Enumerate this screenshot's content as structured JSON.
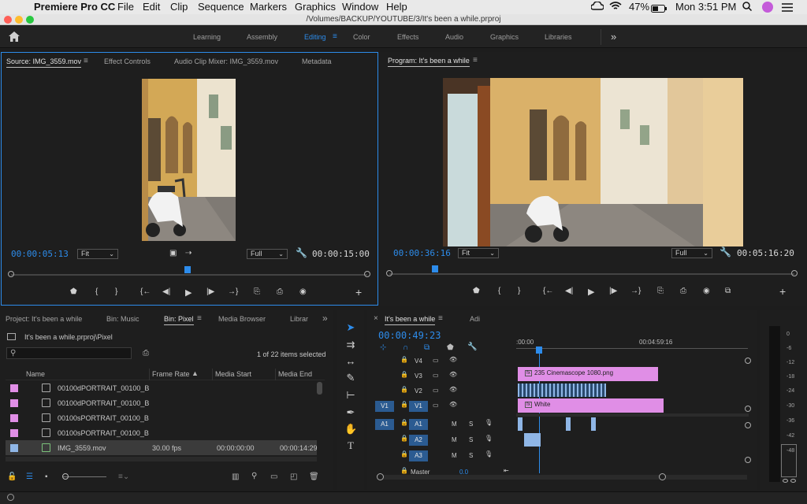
{
  "menubar": {
    "apple": "",
    "app_name": "Premiere Pro CC",
    "items": [
      "File",
      "Edit",
      "Clip",
      "Sequence",
      "Markers",
      "Graphics",
      "Window",
      "Help"
    ],
    "battery": "47%",
    "clock": "Mon 3:51 PM"
  },
  "window": {
    "title": "/Volumes/BACKUP/YOUTUBE/3/It's been a while.prproj"
  },
  "workspaces": {
    "items": [
      "Learning",
      "Assembly",
      "Editing",
      "Color",
      "Effects",
      "Audio",
      "Graphics",
      "Libraries"
    ],
    "active": "Editing",
    "more": "»"
  },
  "source_monitor": {
    "tabs": [
      "Source: IMG_3559.mov",
      "Effect Controls",
      "Audio Clip Mixer: IMG_3559.mov",
      "Metadata"
    ],
    "timecode": "00:00:05:13",
    "fit": "Fit",
    "quality": "Full",
    "duration": "00:00:15:00"
  },
  "program_monitor": {
    "tab": "Program: It's been a while",
    "timecode": "00:00:36:16",
    "fit": "Fit",
    "quality": "Full",
    "duration": "00:05:16:20"
  },
  "project_panel": {
    "tabs": [
      "Project: It's been a while",
      "Bin: Music",
      "Bin: Pixel",
      "Media Browser",
      "Librar"
    ],
    "path": "It's been a while.prproj\\Pixel",
    "search_placeholder": "",
    "count": "1 of 22 items selected",
    "columns": [
      "Name",
      "Frame Rate",
      "Media Start",
      "Media End"
    ],
    "rows": [
      {
        "name": "00100dPORTRAIT_00100_B",
        "frame_rate": "",
        "media_start": "",
        "media_end": "",
        "color": "#e08ee6"
      },
      {
        "name": "00100dPORTRAIT_00100_B",
        "frame_rate": "",
        "media_start": "",
        "media_end": "",
        "color": "#e08ee6"
      },
      {
        "name": "00100sPORTRAIT_00100_B",
        "frame_rate": "",
        "media_start": "",
        "media_end": "",
        "color": "#e08ee6"
      },
      {
        "name": "00100sPORTRAIT_00100_B",
        "frame_rate": "",
        "media_start": "",
        "media_end": "",
        "color": "#e08ee6"
      },
      {
        "name": "IMG_3559.mov",
        "frame_rate": "30.00 fps",
        "media_start": "00:00:00:00",
        "media_end": "00:00:14:29",
        "color": "#8fb6e6"
      }
    ]
  },
  "timeline": {
    "tab": "It's been a while",
    "tab2": "Adi",
    "timecode": "00:00:49:23",
    "ruler_start": ":00:00",
    "ruler_mark": "00:04:59:16",
    "video_tracks": [
      "V4",
      "V3",
      "V2",
      "V1"
    ],
    "audio_tracks": [
      "A1",
      "A2",
      "A3"
    ],
    "source_v": "V1",
    "source_a": "A1",
    "master_label": "Master",
    "master_value": "0.0",
    "mute": "M",
    "solo": "S",
    "clips": {
      "v3": "235 Cinemascope 1080.png",
      "v1": "White"
    }
  },
  "meter": {
    "labels": [
      "0",
      "-6",
      "-12",
      "-18",
      "-24",
      "-30",
      "-36",
      "-42",
      "-48"
    ]
  }
}
